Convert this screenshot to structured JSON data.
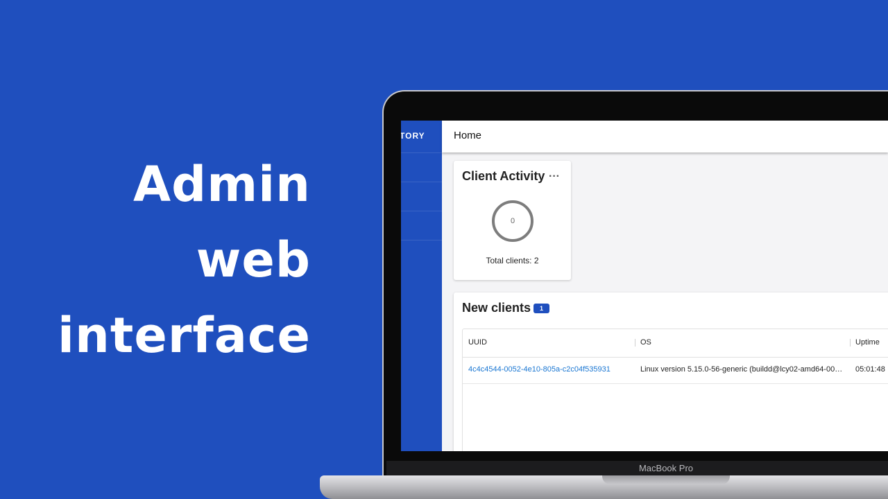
{
  "headline": {
    "lines": [
      "Admin",
      "web",
      "interface"
    ]
  },
  "device": {
    "brand_label": "MacBook Pro"
  },
  "app": {
    "sidebar": {
      "brand_fragment": "TORY"
    },
    "header": {
      "title": "Home"
    },
    "client_activity": {
      "title": "Client Activity",
      "menu_icon": "more-horizontal-icon",
      "active_count": "0",
      "total_label": "Total clients: 2"
    },
    "new_clients": {
      "title": "New clients",
      "badge_count": "1",
      "columns": [
        "UUID",
        "OS",
        "Uptime"
      ],
      "rows": [
        {
          "uuid": "4c4c4544-0052-4e10-805a-c2c04f535931",
          "os": "Linux version 5.15.0-56-generic (buildd@lcy02-amd64-004) (…",
          "uptime": "05:01:48"
        }
      ]
    },
    "colors": {
      "accent": "#1f4fbe",
      "link": "#1976d2"
    }
  }
}
